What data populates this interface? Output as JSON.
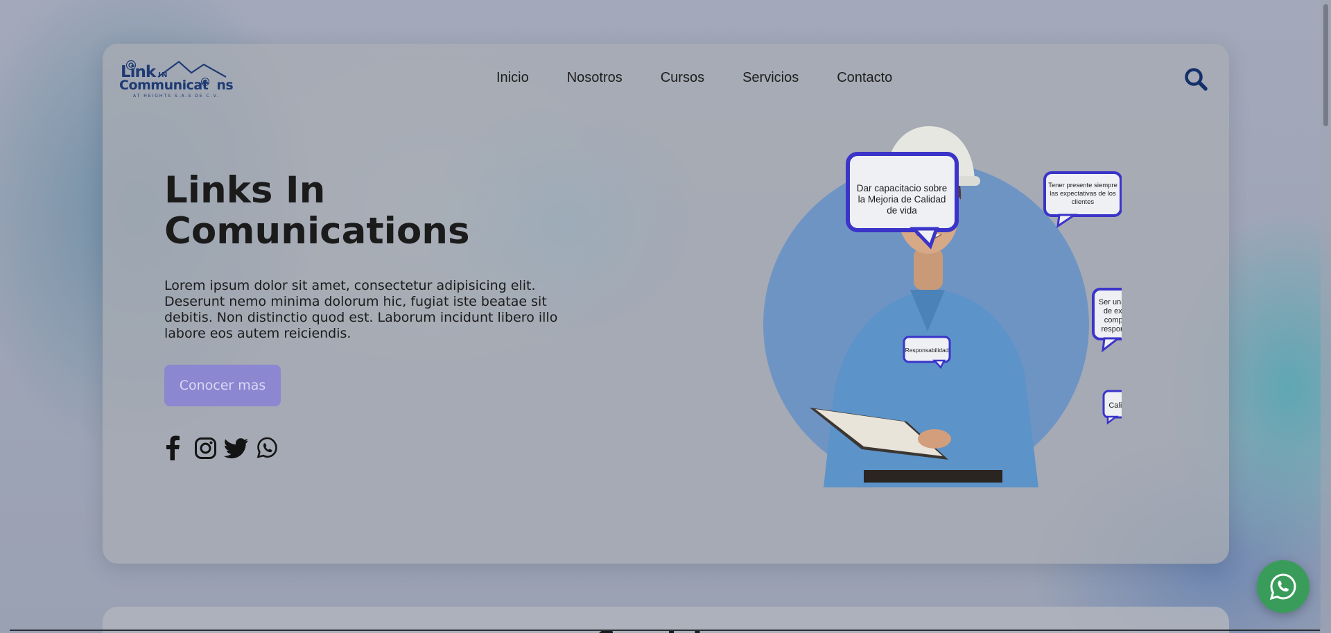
{
  "logo": {
    "line1": "Link",
    "line1_small": "IN",
    "line2": "Communicat",
    "line2_end": "ns",
    "line3": "AT HEIGHTS S.A.S DE C.V."
  },
  "nav": {
    "items": [
      "Inicio",
      "Nosotros",
      "Cursos",
      "Servicios",
      "Contacto"
    ]
  },
  "hero": {
    "title": "Links In Comunications",
    "description": "Lorem ipsum dolor sit amet, consectetur adipisicing elit. Deserunt nemo minima dolorum hic, fugiat iste beatae sit debitis. Non distinctio quod est. Laborum incidunt libero illo labore eos autem reiciendis.",
    "cta_label": "Conocer mas"
  },
  "hero_image": {
    "bubbles": {
      "b1": [
        "Dar capacitacio sobre",
        "la Mejoria de Calidad",
        "de vida"
      ],
      "b2": [
        "Tener presente siempre",
        "las expectativas de los",
        "clientes"
      ],
      "b3": [
        "Ser una empresa",
        "de excelencia,",
        "compromiso y",
        "responsabilidad"
      ],
      "b4": [
        "Responsabilidad"
      ],
      "b5": [
        "Calidad"
      ]
    }
  },
  "social_icons": [
    "facebook-icon",
    "instagram-icon",
    "twitter-icon",
    "whatsapp-icon"
  ],
  "next_section": {
    "heading": "Servicios"
  },
  "colors": {
    "brand_navy": "#1f3b73",
    "cta_bg": "#8b87d1",
    "whatsapp_green": "#3a9c5a",
    "bubble_stroke": "#3b34c8"
  }
}
